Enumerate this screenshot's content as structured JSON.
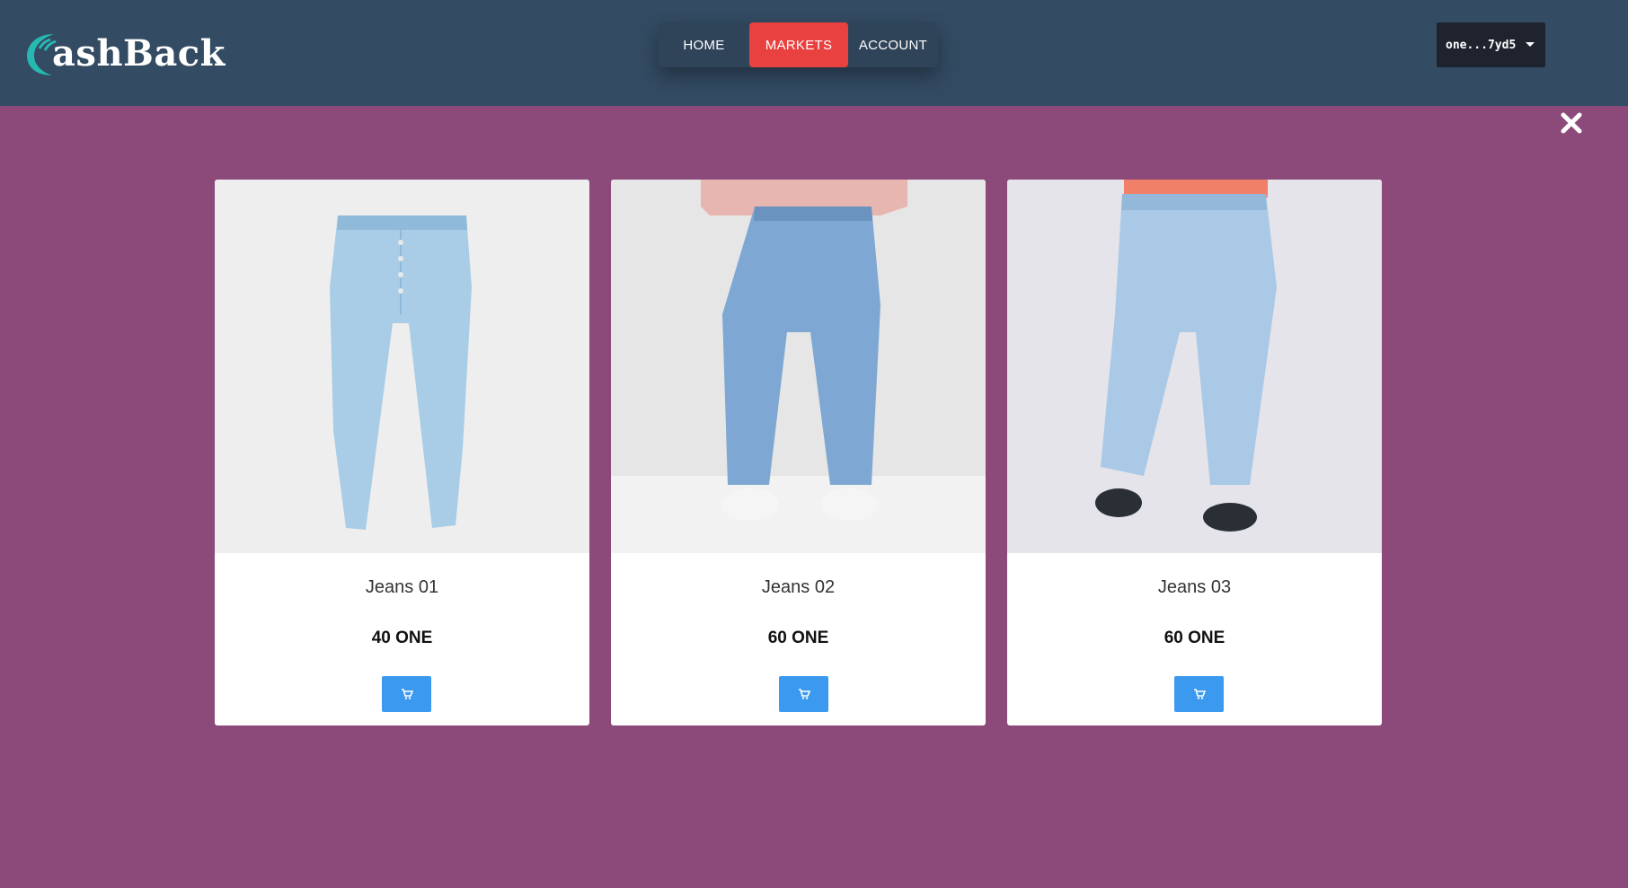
{
  "header": {
    "logo_text": "ashBack",
    "logo_text_full": "CashBack",
    "nav": [
      {
        "label": "HOME"
      },
      {
        "label": "MARKETS",
        "active": true
      },
      {
        "label": "ACCOUNT"
      }
    ],
    "wallet_label": "one...7yd5"
  },
  "colors": {
    "header_bg": "#334b63",
    "page_bg": "#8c4a7b",
    "active_nav": "#e8413f",
    "cart_button": "#3b99ef",
    "wallet_bg": "#1e232e"
  },
  "icons": {
    "close": "close-icon",
    "cart": "cart-icon",
    "dropdown": "caret-down-icon",
    "logo": "cashback-logo-icon"
  },
  "products": [
    {
      "name": "Jeans 01",
      "price": "40 ONE"
    },
    {
      "name": "Jeans 02",
      "price": "60 ONE"
    },
    {
      "name": "Jeans 03",
      "price": "60 ONE"
    }
  ]
}
